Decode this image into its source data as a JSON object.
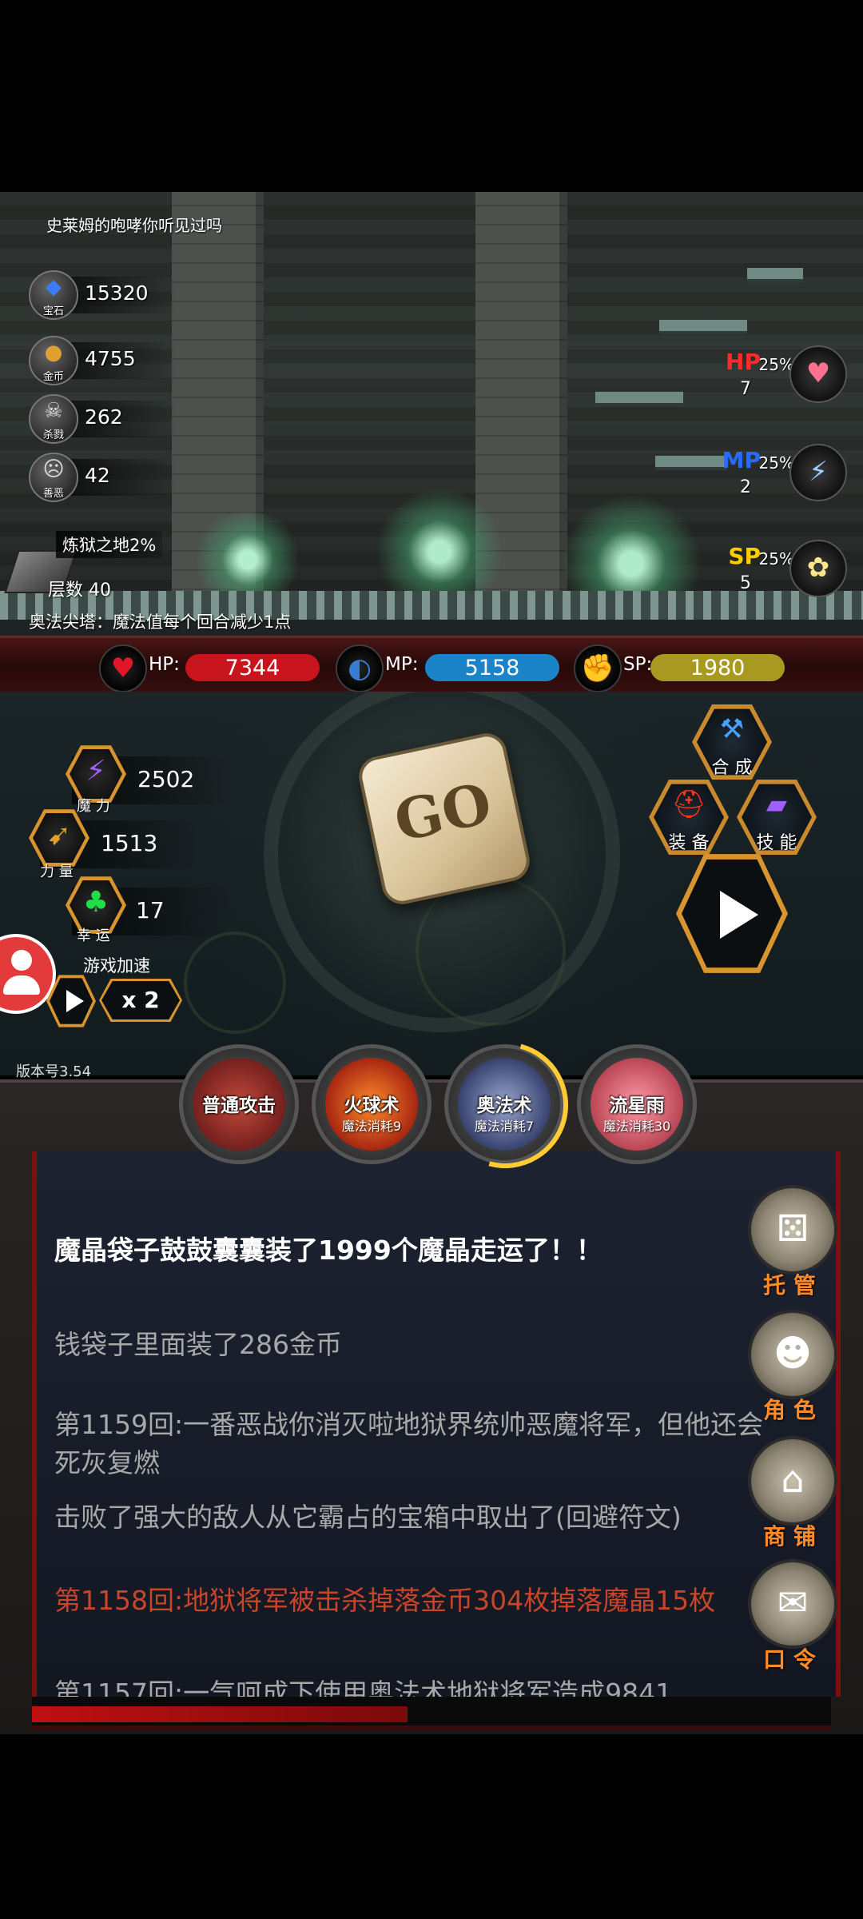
{
  "scene": {
    "title": "史莱姆的咆哮你听见过吗",
    "resources": [
      {
        "name": "gem",
        "caption": "宝石",
        "value": "15320",
        "icon": "gem-icon",
        "glyph": "◆",
        "color": "#3a7bff"
      },
      {
        "name": "coin",
        "caption": "金币",
        "value": "4755",
        "icon": "coin-icon",
        "glyph": "●",
        "color": "#e0a030"
      },
      {
        "name": "kills",
        "caption": "杀戮",
        "value": "262",
        "icon": "skull-icon",
        "glyph": "☠",
        "color": "#dddddd"
      },
      {
        "name": "evil",
        "caption": "善恶",
        "value": "42",
        "icon": "mask-icon",
        "glyph": "☹",
        "color": "#dddddd"
      }
    ],
    "floor_name": "炼狱之地2%",
    "floor_count": "层数 40",
    "tower_note": "奥法尖塔：魔法值每个回合减少1点",
    "potions": [
      {
        "type": "HP",
        "color": "#ff2a2a",
        "percent": "25%",
        "count": "7",
        "icon": "hp-potion-icon",
        "glyph": "♥"
      },
      {
        "type": "MP",
        "color": "#2a6bff",
        "percent": "25%",
        "count": "2",
        "icon": "mp-potion-icon",
        "glyph": "⚡"
      },
      {
        "type": "SP",
        "color": "#ffcc00",
        "percent": "25%",
        "count": "5",
        "icon": "sp-food-icon",
        "glyph": "✿"
      }
    ]
  },
  "stats": {
    "hp": {
      "label": "HP:",
      "value": "7344",
      "color": "#c8141c",
      "icon": "heart-icon",
      "glyph": "♥"
    },
    "mp": {
      "label": "MP:",
      "value": "5158",
      "color": "#1b83c8",
      "icon": "mp-boot-icon",
      "glyph": "◐"
    },
    "sp": {
      "label": "SP:",
      "value": "1980",
      "color": "#a89a20",
      "icon": "strength-icon",
      "glyph": "✊"
    }
  },
  "attributes": [
    {
      "name": "magic",
      "caption": "魔 力",
      "value": "2502",
      "icon": "lightning-icon",
      "glyph": "⚡",
      "color": "#a060ff"
    },
    {
      "name": "power",
      "caption": "力 量",
      "value": "1513",
      "icon": "crossbow-icon",
      "glyph": "➹",
      "color": "#e0a030"
    },
    {
      "name": "luck",
      "caption": "幸 运",
      "value": "17",
      "icon": "clover-icon",
      "glyph": "♣",
      "color": "#22dd44"
    }
  ],
  "dice_label": "GO",
  "menu": {
    "craft": {
      "label": "合 成",
      "icon": "craft-icon",
      "glyph": "⚒",
      "color": "#4aa0ff"
    },
    "equip": {
      "label": "装 备",
      "icon": "helmet-icon",
      "glyph": "⛑",
      "color": "#ff3322"
    },
    "skill": {
      "label": "技 能",
      "icon": "book-icon",
      "glyph": "▰",
      "color": "#a060ff"
    }
  },
  "speed": {
    "label": "游戏加速",
    "value": "x 2"
  },
  "version": "版本号3.54",
  "skills": [
    {
      "name": "普通攻击",
      "cost": "",
      "icon": "sword-icon",
      "face": "#8a2a2a"
    },
    {
      "name": "火球术",
      "cost": "魔法消耗9",
      "icon": "fireball-icon",
      "face": "#b33a1a"
    },
    {
      "name": "奥法术",
      "cost": "魔法消耗7",
      "icon": "arcane-icon",
      "face": "#3a4a7a"
    },
    {
      "name": "流星雨",
      "cost": "魔法消耗30",
      "icon": "meteor-icon",
      "face": "#c0505a"
    }
  ],
  "log": [
    {
      "text": "魔晶袋子鼓鼓囊囊装了1999个魔晶走运了！！",
      "color": "#ffffff",
      "bold": true
    },
    {
      "text": "钱袋子里面装了286金币",
      "color": "#a8a8a8",
      "bold": false
    },
    {
      "text": "第1159回:一番恶战你消灭啦地狱界统帅恶魔将军，但他还会死灰复燃",
      "color": "#a8a8a8",
      "bold": false
    },
    {
      "text": "击败了强大的敌人从它霸占的宝箱中取出了(回避符文)",
      "color": "#a8a8a8",
      "bold": false
    },
    {
      "text": "第1158回:地狱将军被击杀掉落金币304枚掉落魔晶15枚",
      "color": "#c8452a",
      "bold": false
    },
    {
      "text": "第1157回:一气呵成下使用奥法术地狱将军造成9841",
      "color": "#a8a8a8",
      "bold": false
    }
  ],
  "side_buttons": [
    {
      "label": "托 管",
      "icon": "dice-icon",
      "glyph": "⚄"
    },
    {
      "label": "角 色",
      "icon": "hooded-figure-icon",
      "glyph": "☻"
    },
    {
      "label": "商 铺",
      "icon": "shop-icon",
      "glyph": "⌂"
    },
    {
      "label": "口 令",
      "icon": "scroll-icon",
      "glyph": "✉"
    }
  ]
}
